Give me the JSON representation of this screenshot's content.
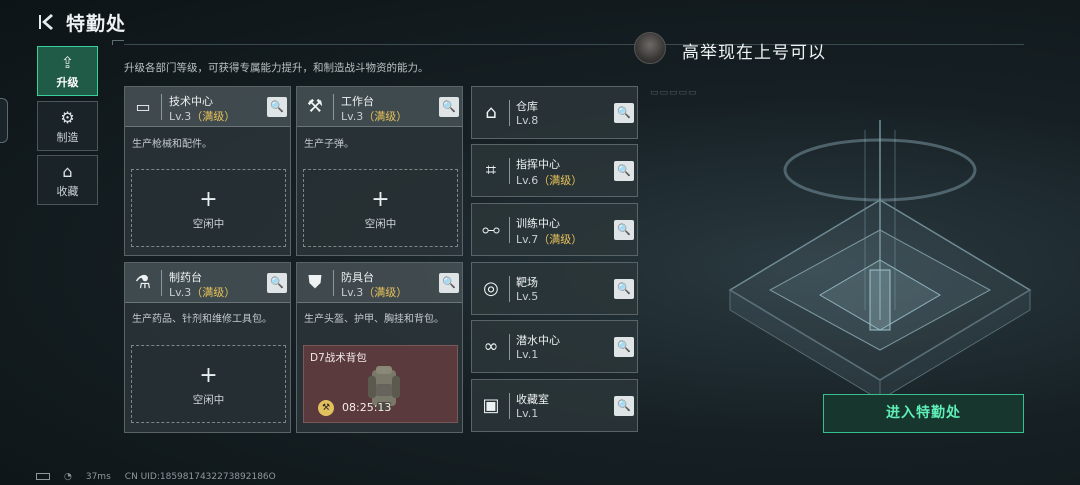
{
  "header": {
    "title": "特勤处",
    "subtitle": "升级各部门等级，可获得专属能力提升，和制造战斗物资的能力。"
  },
  "tabs": [
    {
      "label": "升级",
      "icon": "upgrade-icon",
      "active": true
    },
    {
      "label": "制造",
      "icon": "gear-icon",
      "active": false
    },
    {
      "label": "收藏",
      "icon": "collection-icon",
      "active": false
    }
  ],
  "departments": [
    {
      "name": "技术中心",
      "level": "Lv.3",
      "max": "（满级）",
      "desc": "生产枪械和配件。",
      "slot_state": "空闲中",
      "icon": "monitor-icon"
    },
    {
      "name": "工作台",
      "level": "Lv.3",
      "max": "（满级）",
      "desc": "生产子弹。",
      "slot_state": "空闲中",
      "icon": "tools-icon"
    },
    {
      "name": "制药台",
      "level": "Lv.3",
      "max": "（满级）",
      "desc": "生产药品、针剂和维修工具包。",
      "slot_state": "空闲中",
      "icon": "microscope-icon"
    },
    {
      "name": "防具台",
      "level": "Lv.3",
      "max": "（满级）",
      "desc": "生产头盔、护甲、胸挂和背包。",
      "icon": "armor-icon"
    }
  ],
  "production": {
    "item": "D7战术背包",
    "time": "08:25:13"
  },
  "facilities": [
    {
      "name": "仓库",
      "level": "Lv.8",
      "max": "",
      "icon": "warehouse-icon"
    },
    {
      "name": "指挥中心",
      "level": "Lv.6",
      "max": "（满级）",
      "icon": "chip-icon"
    },
    {
      "name": "训练中心",
      "level": "Lv.7",
      "max": "（满级）",
      "icon": "dumbbell-icon"
    },
    {
      "name": "靶场",
      "level": "Lv.5",
      "max": "",
      "icon": "target-icon"
    },
    {
      "name": "潜水中心",
      "level": "Lv.1",
      "max": "",
      "icon": "diving-mask-icon"
    },
    {
      "name": "收藏室",
      "level": "Lv.1",
      "max": "",
      "icon": "display-case-icon"
    }
  ],
  "chat": {
    "text": "高举现在上号可以"
  },
  "enter_button": "进入特勤处",
  "footer": {
    "ping": "37ms",
    "uid": "CN UID:1859817432273892186O"
  },
  "colors": {
    "accent_green": "#35c08e",
    "max_level": "#e7c25a",
    "production_bg": "#5a3a3d"
  }
}
